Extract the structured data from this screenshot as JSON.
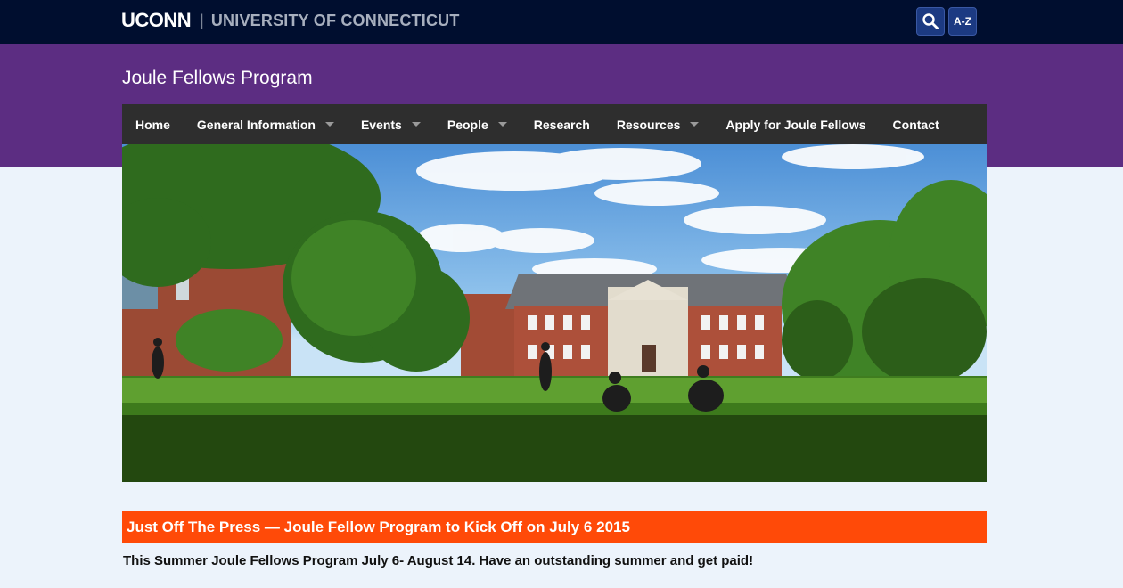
{
  "header": {
    "logo_text": "UCONN",
    "separator": "|",
    "university_name": "UNIVERSITY OF CONNECTICUT",
    "search_icon": "search-icon",
    "az_label": "A-Z"
  },
  "site": {
    "title": "Joule Fellows Program"
  },
  "nav": {
    "items": [
      {
        "label": "Home",
        "dropdown": false
      },
      {
        "label": "General Information",
        "dropdown": true
      },
      {
        "label": "Events",
        "dropdown": true
      },
      {
        "label": "People",
        "dropdown": true
      },
      {
        "label": "Research",
        "dropdown": false
      },
      {
        "label": "Resources",
        "dropdown": true
      },
      {
        "label": "Apply for Joule Fellows",
        "dropdown": false
      },
      {
        "label": "Contact",
        "dropdown": false
      }
    ]
  },
  "news": {
    "headline": "Just Off The Press — Joule Fellow Program to Kick Off on July 6 2015",
    "summary": "This Summer Joule Fellows Program July 6- August 14. Have an outstanding summer and get paid!"
  },
  "colors": {
    "topbar": "#000e2f",
    "brand_purple": "#5c2d82",
    "nav_bg": "#2e2e2e",
    "news_orange": "#ff4a08",
    "page_bg": "#ecf3fb"
  }
}
